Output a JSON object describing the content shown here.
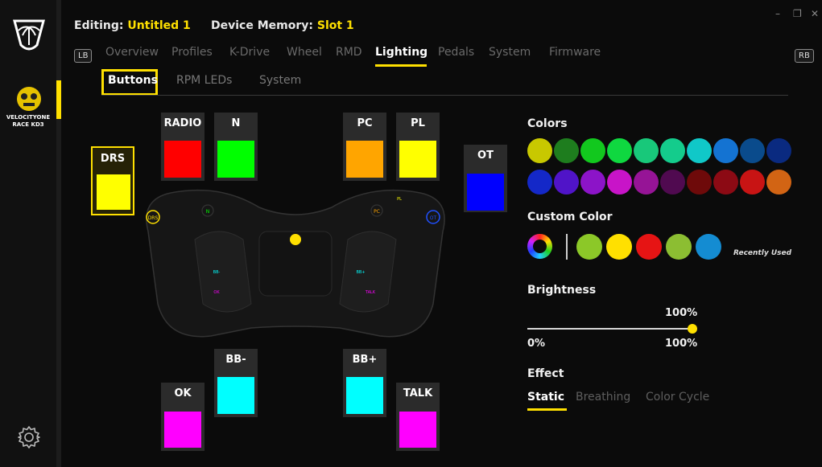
{
  "header": {
    "editing_label": "Editing:",
    "editing_value": "Untitled 1",
    "memory_label": "Device Memory:",
    "memory_value": "Slot 1",
    "window_controls": [
      "–",
      "❐",
      "✕"
    ]
  },
  "sidebar": {
    "device_line1": "VELOCITYONE",
    "device_line2": "RACE KD3"
  },
  "nav": {
    "lb": "LB",
    "rb": "RB",
    "tabs": [
      "Overview",
      "Profiles",
      "K-Drive",
      "Wheel",
      "RMD",
      "Lighting",
      "Pedals",
      "System",
      "Firmware"
    ],
    "active_tab": "Lighting"
  },
  "subnav": {
    "tabs": [
      "Buttons",
      "RPM LEDs",
      "System"
    ],
    "active": "Buttons"
  },
  "buttons": [
    {
      "label": "DRS",
      "color": "#ffff00"
    },
    {
      "label": "RADIO",
      "color": "#ff0000"
    },
    {
      "label": "N",
      "color": "#00ff00"
    },
    {
      "label": "PC",
      "color": "#ffa500"
    },
    {
      "label": "PL",
      "color": "#ffff00"
    },
    {
      "label": "OT",
      "color": "#0000ff"
    },
    {
      "label": "BB-",
      "color": "#00ffff"
    },
    {
      "label": "BB+",
      "color": "#00ffff"
    },
    {
      "label": "OK",
      "color": "#ff00ff"
    },
    {
      "label": "TALK",
      "color": "#ff00ff"
    }
  ],
  "wheel": {
    "labels": [
      "DRS",
      "N",
      "PC",
      "OT",
      "PL",
      "BB-",
      "BB+",
      "OK",
      "TALK"
    ]
  },
  "colors": {
    "title": "Colors",
    "palette": [
      "#c8c800",
      "#1e7d1e",
      "#12c81e",
      "#0fd840",
      "#18c87a",
      "#14cc8c",
      "#10c8c8",
      "#1473d2",
      "#0a4b8c",
      "#0a2a80",
      "#1428c8",
      "#5014c8",
      "#8c14c8",
      "#c814c8",
      "#961496",
      "#500a50",
      "#6e0a0a",
      "#8c0a14",
      "#c81414",
      "#d26414"
    ]
  },
  "custom_color": {
    "title": "Custom Color",
    "recent": [
      "#8cc828",
      "#ffe000",
      "#e61414",
      "#8cbe32",
      "#148cd2"
    ],
    "recent_label": "Recently Used"
  },
  "brightness": {
    "title": "Brightness",
    "value": 100,
    "value_label": "100%",
    "min_label": "0%",
    "max_label": "100%"
  },
  "effect": {
    "title": "Effect",
    "options": [
      "Static",
      "Breathing",
      "Color Cycle"
    ],
    "active": "Static"
  }
}
